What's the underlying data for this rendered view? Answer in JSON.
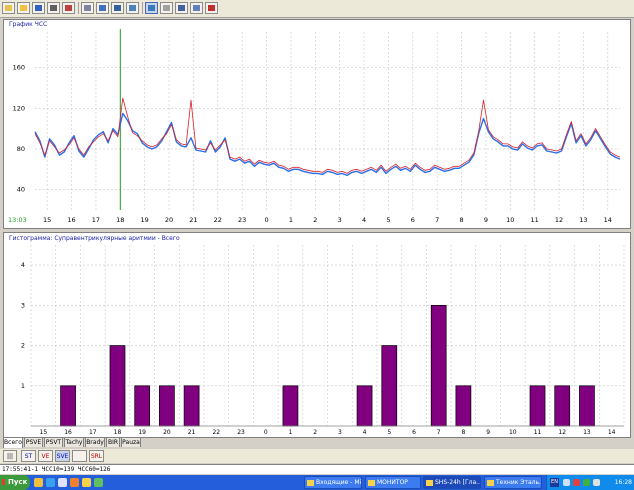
{
  "toolbar": {
    "buttons": [
      "open-icon",
      "folder-icon",
      "save-icon",
      "print-icon",
      "tools-icon",
      "list-icon",
      "window-icon",
      "grid-icon",
      "layout-icon",
      "chart-icon",
      "edit-icon",
      "pen-icon",
      "marker-icon",
      "histogram-icon"
    ],
    "active_button": "chart-icon"
  },
  "hr_panel": {
    "title": "График ЧСС",
    "corner_label": "13:03",
    "chart_data": {
      "type": "line",
      "x_tick_labels": [
        "15",
        "16",
        "17",
        "18",
        "19",
        "20",
        "21",
        "22",
        "23",
        "0",
        "1",
        "2",
        "3",
        "4",
        "5",
        "6",
        "7",
        "8",
        "9",
        "10",
        "11",
        "12",
        "13",
        "14"
      ],
      "y_tick_labels": [
        "40",
        "80",
        "120",
        "160"
      ],
      "ylim": [
        20,
        195
      ],
      "grid": true,
      "cursor_at_hour": 18,
      "start_hour": 14.5,
      "series": [
        {
          "color": "#2a6fe8",
          "x": [
            14.5,
            14.7,
            14.9,
            15.1,
            15.3,
            15.5,
            15.7,
            15.9,
            16.1,
            16.3,
            16.5,
            16.7,
            16.9,
            17.1,
            17.3,
            17.5,
            17.7,
            17.9,
            18.1,
            18.3,
            18.5,
            18.7,
            18.9,
            19.1,
            19.3,
            19.5,
            19.7,
            19.9,
            20.1,
            20.3,
            20.5,
            20.7,
            20.9,
            21.1,
            21.3,
            21.5,
            21.7,
            21.9,
            22.1,
            22.3,
            22.5,
            22.7,
            22.9,
            23.1,
            23.3,
            23.5,
            23.7,
            23.9,
            24.1,
            24.3,
            24.5,
            24.7,
            24.9,
            25.1,
            25.3,
            25.5,
            25.7,
            25.9,
            26.1,
            26.3,
            26.5,
            26.7,
            26.9,
            27.1,
            27.3,
            27.5,
            27.7,
            27.9,
            28.1,
            28.3,
            28.5,
            28.7,
            28.9,
            29.1,
            29.3,
            29.5,
            29.7,
            29.9,
            30.1,
            30.3,
            30.5,
            30.7,
            30.9,
            31.1,
            31.3,
            31.5,
            31.7,
            31.9,
            32.1,
            32.3,
            32.5,
            32.7,
            32.9,
            33.1,
            33.3,
            33.5,
            33.7,
            33.9,
            34.1,
            34.3,
            34.5,
            34.7,
            34.9,
            35.1,
            35.3,
            35.5,
            35.7,
            35.9,
            36.1,
            36.3,
            36.5,
            36.7,
            36.9,
            37.1,
            37.3,
            37.5,
            37.7,
            37.9,
            38.1,
            38.3,
            38.5
          ],
          "values": [
            97,
            88,
            72,
            90,
            84,
            74,
            77,
            86,
            93,
            78,
            72,
            80,
            89,
            94,
            97,
            86,
            100,
            94,
            115,
            108,
            98,
            95,
            86,
            82,
            80,
            82,
            88,
            97,
            106,
            87,
            83,
            82,
            91,
            79,
            78,
            77,
            88,
            77,
            82,
            91,
            70,
            68,
            70,
            66,
            68,
            63,
            67,
            65,
            64,
            66,
            62,
            61,
            58,
            60,
            60,
            58,
            57,
            56,
            56,
            55,
            58,
            57,
            55,
            56,
            54,
            57,
            58,
            56,
            58,
            60,
            57,
            62,
            56,
            60,
            63,
            59,
            61,
            58,
            64,
            60,
            57,
            58,
            62,
            60,
            58,
            59,
            61,
            61,
            64,
            67,
            74,
            95,
            110,
            97,
            90,
            87,
            83,
            83,
            80,
            79,
            85,
            81,
            79,
            83,
            84,
            78,
            77,
            76,
            78,
            92,
            105,
            86,
            93,
            83,
            89,
            98,
            90,
            82,
            75,
            72,
            70
          ]
        },
        {
          "color": "#d8202a",
          "x": [
            14.5,
            14.7,
            14.9,
            15.1,
            15.3,
            15.5,
            15.7,
            15.9,
            16.1,
            16.3,
            16.5,
            16.7,
            16.9,
            17.1,
            17.3,
            17.5,
            17.7,
            17.9,
            18.1,
            18.3,
            18.5,
            18.7,
            18.9,
            19.1,
            19.3,
            19.5,
            19.7,
            19.9,
            20.1,
            20.3,
            20.5,
            20.7,
            20.9,
            21.1,
            21.3,
            21.5,
            21.7,
            21.9,
            22.1,
            22.3,
            22.5,
            22.7,
            22.9,
            23.1,
            23.3,
            23.5,
            23.7,
            23.9,
            24.1,
            24.3,
            24.5,
            24.7,
            24.9,
            25.1,
            25.3,
            25.5,
            25.7,
            25.9,
            26.1,
            26.3,
            26.5,
            26.7,
            26.9,
            27.1,
            27.3,
            27.5,
            27.7,
            27.9,
            28.1,
            28.3,
            28.5,
            28.7,
            28.9,
            29.1,
            29.3,
            29.5,
            29.7,
            29.9,
            30.1,
            30.3,
            30.5,
            30.7,
            30.9,
            31.1,
            31.3,
            31.5,
            31.7,
            31.9,
            32.1,
            32.3,
            32.5,
            32.7,
            32.9,
            33.1,
            33.3,
            33.5,
            33.7,
            33.9,
            34.1,
            34.3,
            34.5,
            34.7,
            34.9,
            35.1,
            35.3,
            35.5,
            35.7,
            35.9,
            36.1,
            36.3,
            36.5,
            36.7,
            36.9,
            37.1,
            37.3,
            37.5,
            37.7,
            37.9,
            38.1,
            38.3,
            38.5
          ],
          "values": [
            95,
            86,
            74,
            88,
            82,
            76,
            79,
            84,
            91,
            80,
            74,
            82,
            87,
            92,
            95,
            88,
            98,
            92,
            130,
            112,
            96,
            93,
            88,
            84,
            82,
            84,
            90,
            95,
            104,
            89,
            85,
            84,
            128,
            81,
            80,
            79,
            86,
            79,
            84,
            89,
            72,
            70,
            72,
            68,
            70,
            65,
            69,
            67,
            66,
            68,
            64,
            63,
            60,
            62,
            62,
            60,
            59,
            58,
            58,
            57,
            60,
            59,
            57,
            58,
            56,
            59,
            60,
            58,
            60,
            62,
            59,
            64,
            58,
            62,
            65,
            61,
            63,
            60,
            66,
            62,
            59,
            60,
            64,
            62,
            60,
            61,
            63,
            63,
            66,
            69,
            76,
            97,
            128,
            99,
            92,
            89,
            85,
            85,
            82,
            81,
            87,
            83,
            81,
            85,
            86,
            80,
            79,
            78,
            80,
            94,
            107,
            88,
            95,
            85,
            91,
            100,
            92,
            84,
            77,
            74,
            72
          ]
        }
      ]
    }
  },
  "hist_panel": {
    "title": "Гистограмма: Суправентрикулярные аритмии - Всего",
    "chart_data": {
      "type": "bar",
      "categories": [
        "15",
        "16",
        "17",
        "18",
        "19",
        "20",
        "21",
        "22",
        "23",
        "0",
        "1",
        "2",
        "3",
        "4",
        "5",
        "6",
        "7",
        "8",
        "9",
        "10",
        "11",
        "12",
        "13",
        "14"
      ],
      "values": [
        0,
        1,
        0,
        2,
        1,
        1,
        1,
        0,
        0,
        0,
        1,
        0,
        0,
        1,
        2,
        0,
        3,
        1,
        0,
        0,
        1,
        1,
        1,
        0
      ],
      "y_tick_labels": [
        "1",
        "2",
        "3",
        "4"
      ],
      "ylim": [
        0,
        4.5
      ],
      "bar_color": "#800080",
      "grid": true
    }
  },
  "tabs": [
    {
      "label": "Всего",
      "active": true
    },
    {
      "label": "PSVE",
      "active": false
    },
    {
      "label": "PSVT",
      "active": false
    },
    {
      "label": "Tachy",
      "active": false
    },
    {
      "label": "Brady",
      "active": false
    },
    {
      "label": "BIR",
      "active": false
    },
    {
      "label": "Pauza",
      "active": false
    }
  ],
  "subtools": [
    {
      "label": "ST",
      "color": "#0000c0",
      "active": false
    },
    {
      "label": "VE",
      "color": "#c00000",
      "active": false
    },
    {
      "label": "SVE",
      "color": "#0000c0",
      "active": true
    },
    {
      "label": "",
      "color": "#606060",
      "active": false
    },
    {
      "label": "SRL",
      "color": "#c00000",
      "active": false
    }
  ],
  "statusbar": {
    "text": "17:55:41-1  ЧСС10=139  ЧСС60=126"
  },
  "taskbar": {
    "start_label": "Пуск",
    "tasks": [
      {
        "label": "Входящие - Mi...",
        "active": false
      },
      {
        "label": "МОНИТОР",
        "active": false
      },
      {
        "label": "SHS-24h [Гла...",
        "active": true
      },
      {
        "label": "Техник Эталь...",
        "active": false
      }
    ],
    "lang": "EN",
    "time": "16:28"
  }
}
